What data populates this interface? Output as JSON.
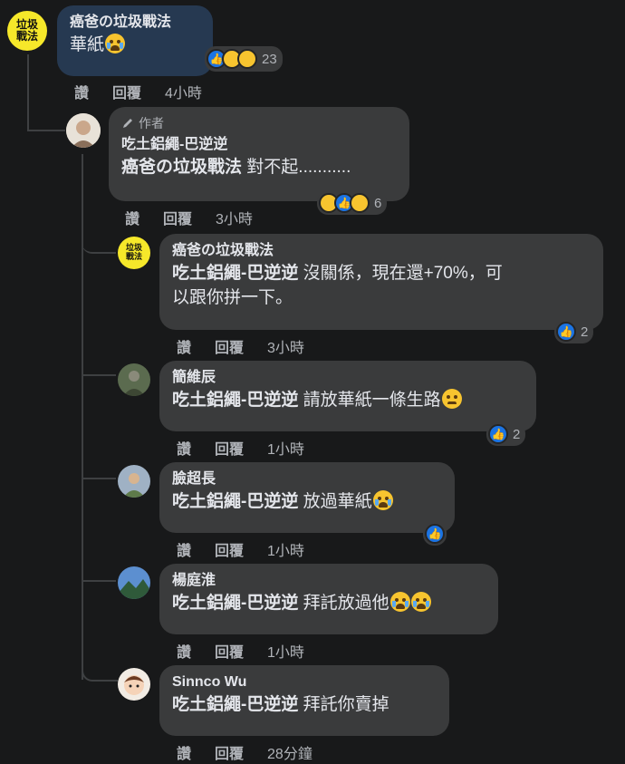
{
  "comments": [
    {
      "author": "癌爸の垃圾戰法",
      "text": "華紙",
      "text_emojis": [
        "crying-face"
      ],
      "reactions": [
        "like",
        "haha",
        "sad"
      ],
      "reaction_count": "23",
      "actions": {
        "like": "讚",
        "reply": "回覆",
        "time": "4小時"
      }
    },
    {
      "badge": "作者",
      "author": "吃土鋁繩-巴逆逆",
      "mention": "癌爸の垃圾戰法",
      "text": "對不起...........",
      "reactions": [
        "haha",
        "like",
        "sad"
      ],
      "reaction_count": "6",
      "actions": {
        "like": "讚",
        "reply": "回覆",
        "time": "3小時"
      }
    },
    {
      "author": "癌爸の垃圾戰法",
      "mention": "吃土鋁繩-巴逆逆",
      "text1": "沒關係，現在還+70%，可",
      "text2": "以跟你拼一下。",
      "reactions": [
        "like"
      ],
      "reaction_count": "2",
      "actions": {
        "like": "讚",
        "reply": "回覆",
        "time": "3小時"
      }
    },
    {
      "author": "簡維辰",
      "mention": "吃土鋁繩-巴逆逆",
      "text": "請放華紙一條生路",
      "text_emojis": [
        "woozy-face"
      ],
      "reactions": [
        "like"
      ],
      "reaction_count": "2",
      "actions": {
        "like": "讚",
        "reply": "回覆",
        "time": "1小時"
      }
    },
    {
      "author": "臉超長",
      "mention": "吃土鋁繩-巴逆逆",
      "text": "放過華紙",
      "text_emojis": [
        "crying-face"
      ],
      "reactions": [
        "like"
      ],
      "actions": {
        "like": "讚",
        "reply": "回覆",
        "time": "1小時"
      }
    },
    {
      "author": "楊庭淮",
      "mention": "吃土鋁繩-巴逆逆",
      "text": "拜託放過他",
      "text_emojis": [
        "crying-face",
        "crying-face"
      ],
      "actions": {
        "like": "讚",
        "reply": "回覆",
        "time": "1小時"
      }
    },
    {
      "author": "Sinnco Wu",
      "mention": "吃土鋁繩-巴逆逆",
      "text": "拜託你賣掉",
      "actions": {
        "like": "讚",
        "reply": "回覆",
        "time": "28分鐘"
      }
    }
  ],
  "logo_text": [
    "垃圾",
    "戰法"
  ],
  "colors": {
    "background": "#18191a",
    "bubble": "#3a3b3c",
    "highlight_bubble": "#263951",
    "like_blue": "#1b74e4",
    "logo_yellow": "#f6e82a"
  }
}
